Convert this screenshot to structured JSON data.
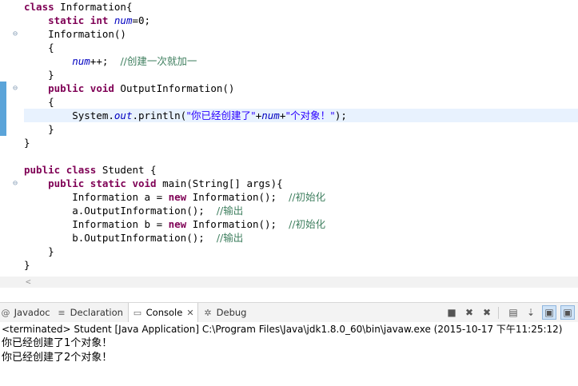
{
  "editor": {
    "lines": [
      [
        {
          "t": "class",
          "k": "kw"
        },
        {
          "t": " Information{"
        }
      ],
      [
        {
          "t": "    "
        },
        {
          "t": "static",
          "k": "kw"
        },
        {
          "t": " "
        },
        {
          "t": "int",
          "k": "kw"
        },
        {
          "t": " "
        },
        {
          "t": "num",
          "k": "fld"
        },
        {
          "t": "=0;"
        }
      ],
      [
        {
          "t": "    Information()"
        }
      ],
      [
        {
          "t": "    {"
        }
      ],
      [
        {
          "t": "        "
        },
        {
          "t": "num",
          "k": "fld"
        },
        {
          "t": "++;  "
        },
        {
          "t": "//创建一次就加一",
          "k": "cmt"
        }
      ],
      [
        {
          "t": "    }"
        }
      ],
      [
        {
          "t": "    "
        },
        {
          "t": "public",
          "k": "kw"
        },
        {
          "t": " "
        },
        {
          "t": "void",
          "k": "kw"
        },
        {
          "t": " OutputInformation()"
        }
      ],
      [
        {
          "t": "    {"
        }
      ],
      [
        {
          "t": "        System."
        },
        {
          "t": "out",
          "k": "fld"
        },
        {
          "t": ".println("
        },
        {
          "t": "\"你已经创建了\"",
          "k": "str"
        },
        {
          "t": "+"
        },
        {
          "t": "num",
          "k": "fld"
        },
        {
          "t": "+"
        },
        {
          "t": "\"个对象！\"",
          "k": "str"
        },
        {
          "t": ");"
        }
      ],
      [
        {
          "t": "    }"
        }
      ],
      [
        {
          "t": "}"
        }
      ],
      [
        {
          "t": ""
        }
      ],
      [
        {
          "t": "public",
          "k": "kw"
        },
        {
          "t": " "
        },
        {
          "t": "class",
          "k": "kw"
        },
        {
          "t": " Student {"
        }
      ],
      [
        {
          "t": "    "
        },
        {
          "t": "public",
          "k": "kw"
        },
        {
          "t": " "
        },
        {
          "t": "static",
          "k": "kw"
        },
        {
          "t": " "
        },
        {
          "t": "void",
          "k": "kw"
        },
        {
          "t": " main(String[] args){"
        }
      ],
      [
        {
          "t": "        Information a = "
        },
        {
          "t": "new",
          "k": "kw"
        },
        {
          "t": " Information();  "
        },
        {
          "t": "//初始化",
          "k": "cmt"
        }
      ],
      [
        {
          "t": "        a.OutputInformation();  "
        },
        {
          "t": "//输出",
          "k": "cmt"
        }
      ],
      [
        {
          "t": "        Information b = "
        },
        {
          "t": "new",
          "k": "kw"
        },
        {
          "t": " Information();  "
        },
        {
          "t": "//初始化",
          "k": "cmt"
        }
      ],
      [
        {
          "t": "        b.OutputInformation();  "
        },
        {
          "t": "//输出",
          "k": "cmt"
        }
      ],
      [
        {
          "t": "    }"
        }
      ],
      [
        {
          "t": "}"
        }
      ]
    ],
    "highlighted_line": 9,
    "fold_markers": [
      3,
      7,
      14
    ],
    "colors": {
      "keyword": "#7f0055",
      "field": "#0000c0",
      "string": "#2a00ff",
      "comment": "#3f7f5f",
      "current_line": "#e8f2fe"
    }
  },
  "tabs": [
    {
      "label": "Javadoc",
      "icon": "at-icon",
      "active": false
    },
    {
      "label": "Declaration",
      "icon": "declaration-icon",
      "active": false
    },
    {
      "label": "Console",
      "icon": "console-icon",
      "active": true,
      "close": "✕"
    },
    {
      "label": "Debug",
      "icon": "debug-icon",
      "active": false
    }
  ],
  "toolbar": [
    {
      "name": "terminate-button",
      "glyph": "■"
    },
    {
      "name": "remove-launch-button",
      "glyph": "✖"
    },
    {
      "name": "remove-all-terminated-button",
      "glyph": "✖"
    },
    {
      "name": "clear-console-button",
      "glyph": "▤"
    },
    {
      "name": "scroll-lock-button",
      "glyph": "⇣"
    },
    {
      "name": "show-console-on-output-button",
      "glyph": "▣"
    },
    {
      "name": "show-console-on-error-button",
      "glyph": "▣"
    }
  ],
  "console": {
    "title": "<terminated> Student [Java Application] C:\\Program Files\\Java\\jdk1.8.0_60\\bin\\javaw.exe (2015-10-17 下午11:25:12)",
    "output": [
      "你已经创建了1个对象！",
      "你已经创建了2个对象！"
    ]
  }
}
